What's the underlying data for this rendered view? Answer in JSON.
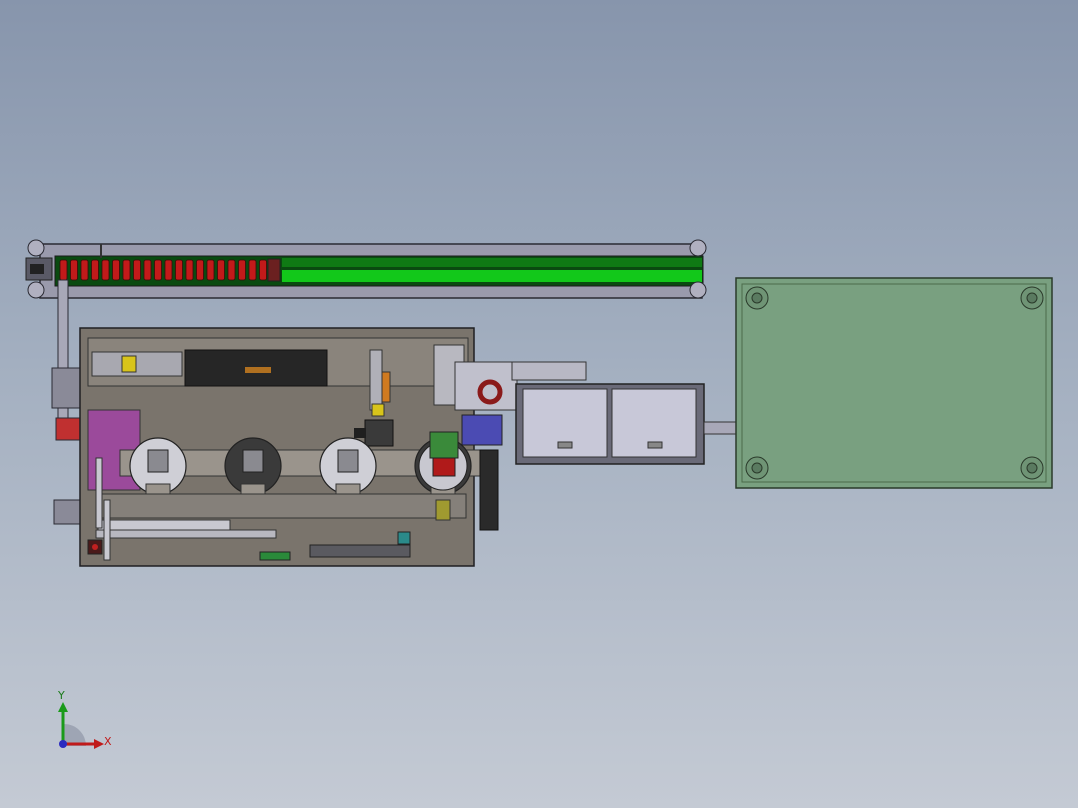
{
  "triad": {
    "x_label": "X",
    "y_label": "Y"
  },
  "colors": {
    "frame": "#8e8ea0",
    "frame_stroke": "#2a2a33",
    "conveyor_green": "#12c81a",
    "conveyor_dark": "#0a4a10",
    "coil_red": "#c21a1a",
    "base_plate": "#7a746c",
    "cabinet_green": "#79a080",
    "bin_face": "#c8c8d8",
    "magenta_block": "#9b4a9b",
    "yellow_part": "#d8c41a",
    "blue_part": "#4b4bb3"
  },
  "assembly": {
    "coil_count": 20,
    "dial_count": 4
  }
}
